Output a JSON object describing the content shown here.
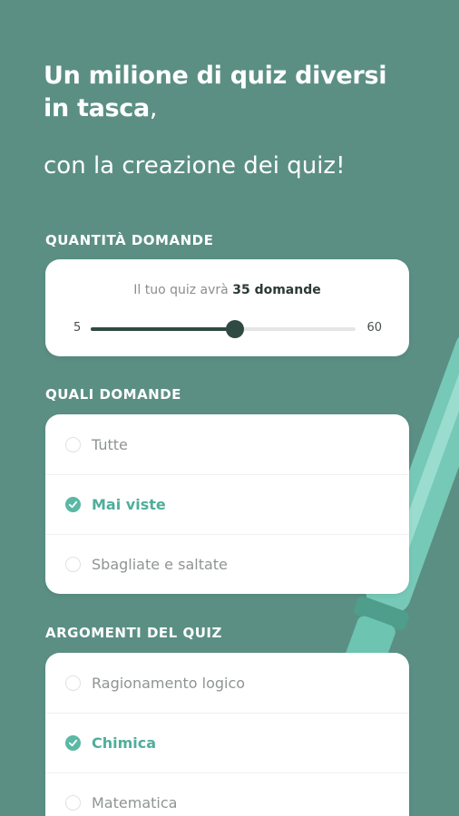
{
  "headline": {
    "bold_line1": "Un milione di quiz diversi",
    "bold_line2": "in tasca",
    "comma": ",",
    "light_line": "con la creazione dei quiz!"
  },
  "quantity": {
    "section_title": "QUANTITÀ DOMANDE",
    "caption_prefix": "Il tuo quiz avrà",
    "caption_value": "35 domande",
    "min_label": "5",
    "max_label": "60",
    "min": 5,
    "max": 60,
    "value": 35
  },
  "which": {
    "section_title": "QUALI DOMANDE",
    "options": [
      {
        "label": "Tutte",
        "checked": false
      },
      {
        "label": "Mai viste",
        "checked": true
      },
      {
        "label": "Sbagliate e saltate",
        "checked": false
      }
    ]
  },
  "topics": {
    "section_title": "ARGOMENTI DEL QUIZ",
    "options": [
      {
        "label": "Ragionamento logico",
        "checked": false
      },
      {
        "label": "Chimica",
        "checked": true
      },
      {
        "label": "Matematica",
        "checked": false
      }
    ]
  },
  "colors": {
    "background": "#5b8f84",
    "accent": "#5bb8a5",
    "slider": "#2f4a42"
  },
  "icons": {
    "check": "check-icon",
    "decoration": "pen-icon"
  }
}
